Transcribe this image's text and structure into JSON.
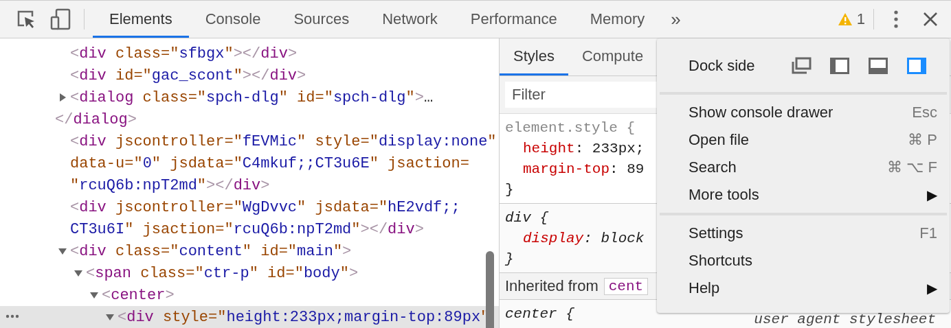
{
  "toolbar": {
    "tabs": [
      {
        "label": "Elements",
        "selected": true
      },
      {
        "label": "Console",
        "selected": false
      },
      {
        "label": "Sources",
        "selected": false
      },
      {
        "label": "Network",
        "selected": false
      },
      {
        "label": "Performance",
        "selected": false
      },
      {
        "label": "Memory",
        "selected": false
      }
    ],
    "overflow": "»",
    "warnings": "1"
  },
  "dom_tree": [
    {
      "selected": false,
      "lines": [
        [
          {
            "kind": "punct",
            "text": "<"
          },
          {
            "kind": "tag",
            "text": "div"
          },
          {
            "kind": "attr",
            "text": " class=\""
          },
          {
            "kind": "value",
            "text": "sfbgx"
          },
          {
            "kind": "attr",
            "text": "\""
          },
          {
            "kind": "punct",
            "text": "></"
          },
          {
            "kind": "tag",
            "text": "div"
          },
          {
            "kind": "punct",
            "text": ">"
          }
        ]
      ]
    },
    {
      "selected": false,
      "lines": [
        [
          {
            "kind": "punct",
            "text": "<"
          },
          {
            "kind": "tag",
            "text": "div"
          },
          {
            "kind": "attr",
            "text": " id=\""
          },
          {
            "kind": "value",
            "text": "gac_scont"
          },
          {
            "kind": "attr",
            "text": "\""
          },
          {
            "kind": "punct",
            "text": "></"
          },
          {
            "kind": "tag",
            "text": "div"
          },
          {
            "kind": "punct",
            "text": ">"
          }
        ]
      ]
    },
    {
      "selected": false,
      "expanded": false,
      "lines": [
        [
          {
            "kind": "punct",
            "text": "<"
          },
          {
            "kind": "tag",
            "text": "dialog"
          },
          {
            "kind": "attr",
            "text": " class=\""
          },
          {
            "kind": "value",
            "text": "spch-dlg"
          },
          {
            "kind": "attr",
            "text": "\" id=\""
          },
          {
            "kind": "value",
            "text": "spch-dlg"
          },
          {
            "kind": "attr",
            "text": "\""
          },
          {
            "kind": "punct",
            "text": ">"
          },
          {
            "kind": "plain",
            "text": "…"
          }
        ],
        [
          {
            "kind": "punct",
            "text": "</"
          },
          {
            "kind": "tag",
            "text": "dialog"
          },
          {
            "kind": "punct",
            "text": ">"
          }
        ]
      ]
    },
    {
      "selected": false,
      "lines": [
        [
          {
            "kind": "punct",
            "text": "<"
          },
          {
            "kind": "tag",
            "text": "div"
          },
          {
            "kind": "attr",
            "text": " jscontroller=\""
          },
          {
            "kind": "value",
            "text": "fEVMic"
          },
          {
            "kind": "attr",
            "text": "\" style=\""
          },
          {
            "kind": "value",
            "text": "display:none"
          },
          {
            "kind": "attr",
            "text": "\""
          }
        ],
        [
          {
            "kind": "attr",
            "text": "data-u=\""
          },
          {
            "kind": "value",
            "text": "0"
          },
          {
            "kind": "attr",
            "text": "\" jsdata=\""
          },
          {
            "kind": "value",
            "text": "C4mkuf;;CT3u6E"
          },
          {
            "kind": "attr",
            "text": "\" jsaction="
          }
        ],
        [
          {
            "kind": "attr",
            "text": "\""
          },
          {
            "kind": "value",
            "text": "rcuQ6b:npT2md"
          },
          {
            "kind": "attr",
            "text": "\""
          },
          {
            "kind": "punct",
            "text": "></"
          },
          {
            "kind": "tag",
            "text": "div"
          },
          {
            "kind": "punct",
            "text": ">"
          }
        ]
      ]
    },
    {
      "selected": false,
      "lines": [
        [
          {
            "kind": "punct",
            "text": "<"
          },
          {
            "kind": "tag",
            "text": "div"
          },
          {
            "kind": "attr",
            "text": " jscontroller=\""
          },
          {
            "kind": "value",
            "text": "WgDvvc"
          },
          {
            "kind": "attr",
            "text": "\" jsdata=\""
          },
          {
            "kind": "value",
            "text": "hE2vdf;;"
          }
        ],
        [
          {
            "kind": "value",
            "text": "CT3u6I"
          },
          {
            "kind": "attr",
            "text": "\" jsaction=\""
          },
          {
            "kind": "value",
            "text": "rcuQ6b:npT2md"
          },
          {
            "kind": "attr",
            "text": "\""
          },
          {
            "kind": "punct",
            "text": "></"
          },
          {
            "kind": "tag",
            "text": "div"
          },
          {
            "kind": "punct",
            "text": ">"
          }
        ]
      ]
    },
    {
      "selected": false,
      "expanded": true,
      "lines": [
        [
          {
            "kind": "punct",
            "text": "<"
          },
          {
            "kind": "tag",
            "text": "div"
          },
          {
            "kind": "attr",
            "text": " class=\""
          },
          {
            "kind": "value",
            "text": "content"
          },
          {
            "kind": "attr",
            "text": "\" id=\""
          },
          {
            "kind": "value",
            "text": "main"
          },
          {
            "kind": "attr",
            "text": "\""
          },
          {
            "kind": "punct",
            "text": ">"
          }
        ]
      ],
      "children": [
        {
          "selected": false,
          "expanded": true,
          "lines": [
            [
              {
                "kind": "punct",
                "text": "<"
              },
              {
                "kind": "tag",
                "text": "span"
              },
              {
                "kind": "attr",
                "text": " class=\""
              },
              {
                "kind": "value",
                "text": "ctr-p"
              },
              {
                "kind": "attr",
                "text": "\" id=\""
              },
              {
                "kind": "value",
                "text": "body"
              },
              {
                "kind": "attr",
                "text": "\""
              },
              {
                "kind": "punct",
                "text": ">"
              }
            ]
          ],
          "children": [
            {
              "selected": false,
              "expanded": true,
              "lines": [
                [
                  {
                    "kind": "punct",
                    "text": "<"
                  },
                  {
                    "kind": "tag",
                    "text": "center"
                  },
                  {
                    "kind": "punct",
                    "text": ">"
                  }
                ]
              ],
              "children": [
                {
                  "selected": true,
                  "expanded": true,
                  "lines": [
                    [
                      {
                        "kind": "punct",
                        "text": "<"
                      },
                      {
                        "kind": "tag",
                        "text": "div"
                      },
                      {
                        "kind": "attr",
                        "text": " style=\""
                      },
                      {
                        "kind": "value",
                        "text": "height:233px;margin-top:89px"
                      },
                      {
                        "kind": "attr",
                        "text": "\""
                      }
                    ]
                  ]
                }
              ]
            }
          ]
        }
      ]
    }
  ],
  "styles_pane": {
    "tabs": [
      {
        "label": "Styles",
        "selected": true
      },
      {
        "label": "Compute",
        "selected": false
      }
    ],
    "filter": {
      "placeholder": "Filter"
    },
    "rules": [
      {
        "kind": "inline",
        "selector": "element.style {",
        "props": [
          {
            "name": "height",
            "value": ": 233px;"
          },
          {
            "name": "margin-top",
            "value": ": 89"
          }
        ],
        "close": "}"
      },
      {
        "kind": "user-agent",
        "selector": "div {",
        "props": [
          {
            "name": "display",
            "value": ": block"
          }
        ],
        "close": "}"
      },
      {
        "kind": "inherited",
        "label": "Inherited from",
        "element": "cent"
      },
      {
        "kind": "user-agent",
        "selector": "center {",
        "origin": "user agent stylesheet"
      }
    ]
  },
  "menu": {
    "dock": {
      "label": "Dock side",
      "options": [
        {
          "kind": "undock",
          "selected": false
        },
        {
          "kind": "left",
          "selected": false
        },
        {
          "kind": "bottom",
          "selected": false
        },
        {
          "kind": "right",
          "selected": true
        }
      ]
    },
    "groups": [
      [
        {
          "label": "Show console drawer",
          "shortcut": "Esc"
        },
        {
          "label": "Open file",
          "shortcut": "⌘ P"
        },
        {
          "label": "Search",
          "shortcut": "⌘ ⌥ F"
        },
        {
          "label": "More tools",
          "shortcut": "▶"
        }
      ],
      [
        {
          "label": "Settings",
          "shortcut": "F1"
        },
        {
          "label": "Shortcuts"
        },
        {
          "label": "Help",
          "shortcut": "▶"
        }
      ]
    ]
  }
}
